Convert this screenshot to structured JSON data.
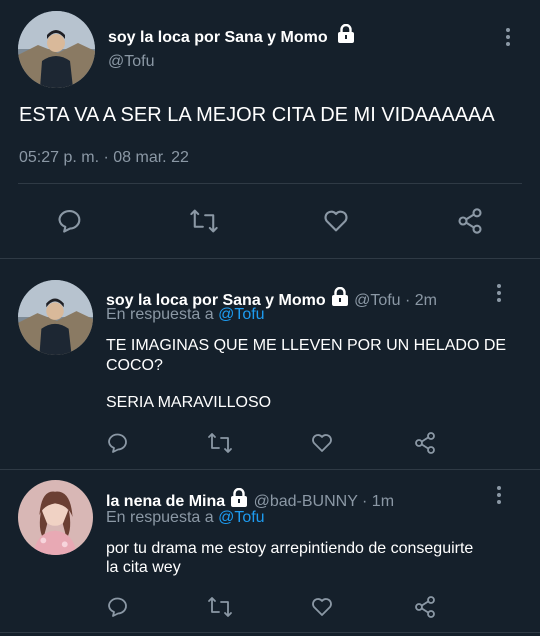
{
  "colors": {
    "background": "#15202b",
    "text": "#ffffff",
    "muted": "#8b98a5",
    "link": "#1d9bf0",
    "divider": "#2f3a45"
  },
  "main_tweet": {
    "display_name": "soy la loca por Sana y Momo",
    "handle": "@Tofu",
    "text": "ESTA VA A SER LA MEJOR CITA DE MI VIDAAAAAA",
    "timestamp": "05:27 p. m. · 08 mar. 22",
    "icons": [
      "lock-icon",
      "more-icon",
      "reply-icon",
      "retweet-icon",
      "like-icon",
      "share-icon"
    ]
  },
  "replies": [
    {
      "display_name": "soy la loca por Sana y Momo",
      "handle_time": "@Tofu · 2m",
      "reply_prefix": "En respuesta a",
      "reply_to": "@Tofu",
      "text_line1": "TE IMAGINAS QUE ME LLEVEN POR UN HELADO DE",
      "text_line2": "COCO?",
      "text_line3": "SERIA MARAVILLOSO"
    },
    {
      "display_name": "la nena de Mina",
      "handle_time": "@bad-BUNNY · 1m",
      "reply_prefix": "En respuesta a",
      "reply_to": "@Tofu",
      "text_line1": "por tu drama me estoy arrepintiendo de conseguirte",
      "text_line2": "la cita wey"
    }
  ]
}
